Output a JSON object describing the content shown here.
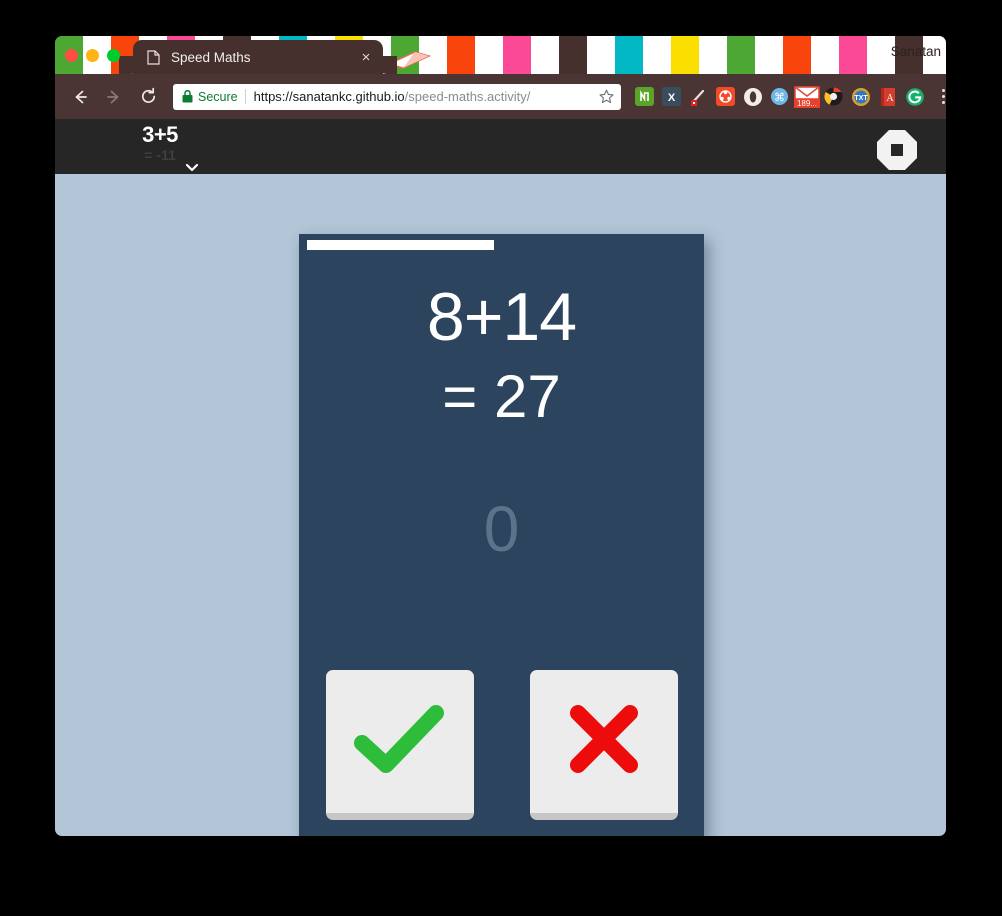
{
  "window": {
    "traffic_lights": [
      "close",
      "minimize",
      "zoom"
    ],
    "profile_name": "Sanatan"
  },
  "tab": {
    "title": "Speed Maths",
    "favicon": "document-icon",
    "close_label": "×"
  },
  "toolbar": {
    "back_label": "←",
    "forward_label": "→",
    "reload_label": "↻",
    "security_label": "Secure",
    "url_origin": "https://sanatankc.github.io",
    "url_path": "/speed-maths.activity/",
    "bookmark_label": "☆",
    "menu_label": "⋮",
    "extensions": [
      {
        "name": "evernote-extension-icon",
        "badge": ""
      },
      {
        "name": "excel-extension-icon",
        "badge": ""
      },
      {
        "name": "eyedropper-extension-icon",
        "badge": ""
      },
      {
        "name": "colorpick-extension-icon",
        "badge": ""
      },
      {
        "name": "opera-extension-icon",
        "badge": ""
      },
      {
        "name": "mendeley-extension-icon",
        "badge": ""
      },
      {
        "name": "gmail-extension-icon",
        "badge": "189..."
      },
      {
        "name": "chrome-extension-icon",
        "badge": ""
      },
      {
        "name": "txt-extension-icon",
        "badge": ""
      },
      {
        "name": "dictionary-extension-icon",
        "badge": ""
      },
      {
        "name": "grammarly-extension-icon",
        "badge": ""
      }
    ]
  },
  "app_header": {
    "mini_question": "3+5",
    "mini_answer": "= -11",
    "expand_label": "⌄",
    "stop_label": "stop-icon"
  },
  "game": {
    "progress_percent": 48,
    "question": "8+14",
    "proposed_answer": "= 27",
    "score": "0",
    "correct_label": "✓",
    "wrong_label": "✗"
  },
  "colors": {
    "page_background": "#b2c6d8",
    "card_background": "#2c445e",
    "accent_white": "#ffffff",
    "score_text": "#5c738b",
    "correct_green": "#2ebd3a",
    "wrong_red": "#ee0b0b",
    "app_header": "#262626",
    "browser_chrome": "#4a3434"
  }
}
